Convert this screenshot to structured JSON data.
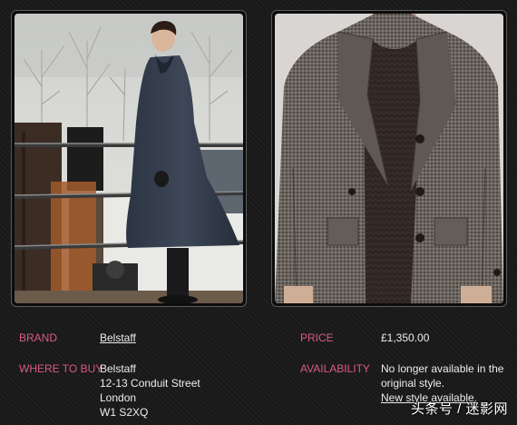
{
  "photos": {
    "left": {
      "subject": "man-in-navy-overcoat-on-pier"
    },
    "right": {
      "subject": "grey-houndstooth-peacoat-closeup"
    }
  },
  "details": {
    "brand_label": "BRAND",
    "brand_value": "Belstaff",
    "where_label": "WHERE TO BUY",
    "where_lines": [
      "Belstaff",
      "12-13 Conduit Street",
      "London",
      "W1 S2XQ"
    ],
    "price_label": "PRICE",
    "price_value": "£1,350.00",
    "availability_label": "AVAILABILITY",
    "availability_lines": [
      "No longer available in the",
      "original style."
    ],
    "availability_link": "New style available."
  },
  "watermark": "头条号 / 迷影网",
  "colors": {
    "label": "#d85c82",
    "text": "#ededed",
    "background": "#191919"
  }
}
